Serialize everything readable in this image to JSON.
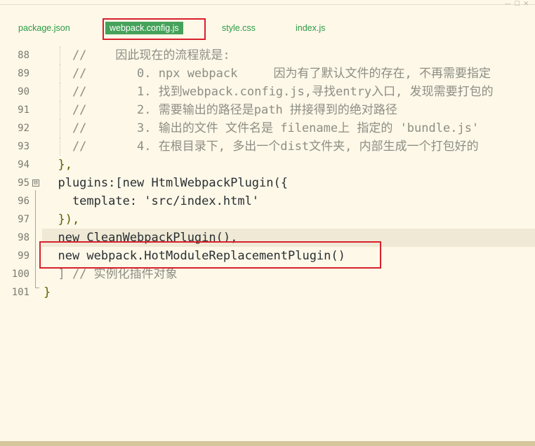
{
  "tabs": [
    {
      "label": "package.json",
      "active": false
    },
    {
      "label": "webpack.config.js",
      "active": true
    },
    {
      "label": "style.css",
      "active": false
    },
    {
      "label": "index.js",
      "active": false
    }
  ],
  "lines": [
    {
      "num": "88",
      "text": "    //    因此现在的流程就是:"
    },
    {
      "num": "89",
      "text": "    //       0. npx webpack     因为有了默认文件的存在, 不再需要指定"
    },
    {
      "num": "90",
      "text": "    //       1. 找到webpack.config.js,寻找entry入口, 发现需要打包的"
    },
    {
      "num": "91",
      "text": "    //       2. 需要输出的路径是path 拼接得到的绝对路径"
    },
    {
      "num": "92",
      "text": "    //       3. 输出的文件 文件名是 filename上 指定的 'bundle.js'"
    },
    {
      "num": "93",
      "text": "    //       4. 在根目录下, 多出一个dist文件夹, 内部生成一个打包好的"
    },
    {
      "num": "94",
      "text": "  },"
    },
    {
      "num": "95",
      "text": "  plugins:[new HtmlWebpackPlugin({"
    },
    {
      "num": "96",
      "text": "    template: 'src/index.html'"
    },
    {
      "num": "97",
      "text": "  }),"
    },
    {
      "num": "98",
      "text": "  new CleanWebpackPlugin(),"
    },
    {
      "num": "99",
      "text": "  new webpack.HotModuleReplacementPlugin()"
    },
    {
      "num": "100",
      "text": "  ] // 实例化插件对象"
    },
    {
      "num": "101",
      "text": "}"
    }
  ],
  "fold_marker": "⊟",
  "colors": {
    "background": "#fdf8e8",
    "active_tab": "#45a25a",
    "highlight_border": "#d8202c",
    "comment": "#8e8e84",
    "keyword": "#6b8f1a",
    "string": "#2d8a6e"
  }
}
